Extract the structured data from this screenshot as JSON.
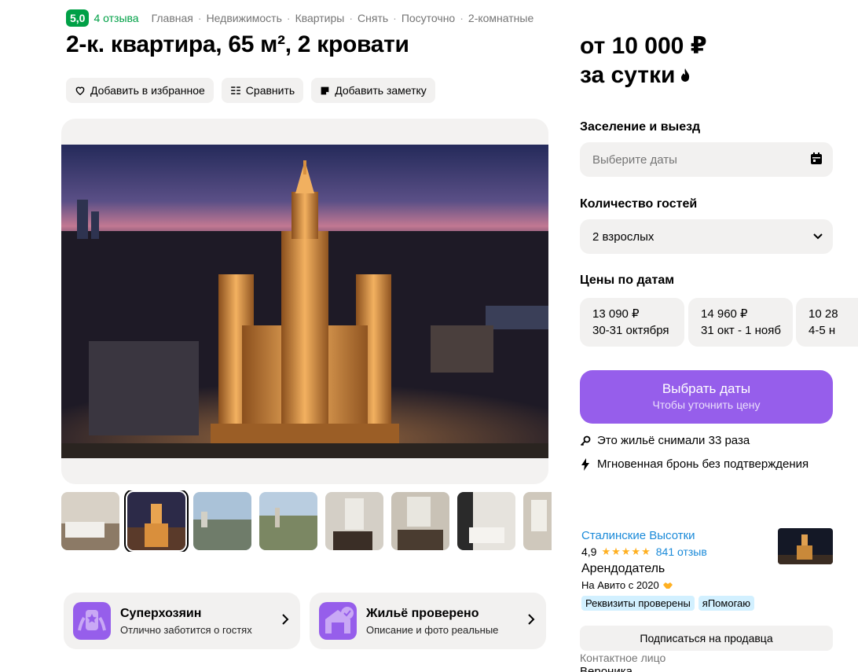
{
  "header": {
    "rating": "5,0",
    "reviews": "4 отзыва",
    "breadcrumbs": [
      "Главная",
      "Недвижимость",
      "Квартиры",
      "Снять",
      "Посуточно",
      "2-комнатные"
    ]
  },
  "title": "2-к. квартира, 65 м², 2 кровати",
  "actions": {
    "favorite": "Добавить в избранное",
    "compare": "Сравнить",
    "note": "Добавить заметку"
  },
  "badges": [
    {
      "title": "Суперхозяин",
      "subtitle": "Отлично заботится о гостях"
    },
    {
      "title": "Жильё проверено",
      "subtitle": "Описание и фото реальные"
    }
  ],
  "booking": {
    "price_line1": "от 10 000 ₽",
    "price_line2": "за сутки",
    "checkin_label": "Заселение и выезд",
    "checkin_placeholder": "Выберите даты",
    "guests_label": "Количество гостей",
    "guests_value": "2 взрослых",
    "prices_label": "Цены по датам",
    "date_prices": [
      {
        "price": "13 090 ₽",
        "dates": "30-31 октября"
      },
      {
        "price": "14 960 ₽",
        "dates": "31 окт - 1 нояб"
      },
      {
        "price": "10 28",
        "dates": "4-5 н"
      }
    ],
    "cta_main": "Выбрать даты",
    "cta_sub": "Чтобы уточнить цену",
    "info_rented": "Это жильё снимали 33 раза",
    "info_instant": "Мгновенная бронь без подтверждения"
  },
  "seller": {
    "name": "Сталинские Высотки",
    "rating": "4,9",
    "stars": "★★★★★",
    "reviews": "841 отзыв",
    "role": "Арендодатель",
    "since": "На Авито с 2020",
    "tags": [
      "Реквизиты проверены",
      "яПомогаю"
    ],
    "subscribe": "Подписаться на продавца",
    "contact_label": "Контактное лицо",
    "contact_name": "Вероника"
  },
  "colors": {
    "green": "#00a046",
    "purple": "#965eeb",
    "link": "#1a8ad9",
    "field_bg": "#f2f1f0"
  }
}
